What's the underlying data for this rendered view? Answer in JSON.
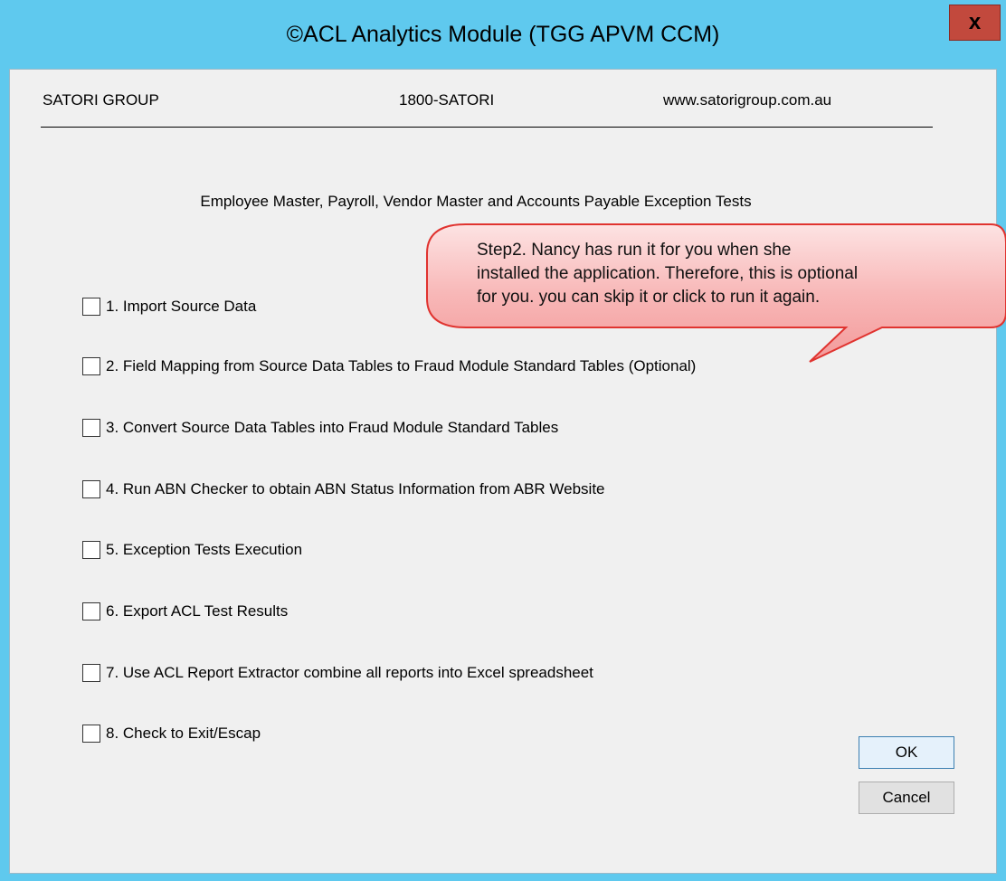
{
  "window": {
    "title": "©ACL Analytics Module (TGG APVM CCM)",
    "close_label": "x"
  },
  "header": {
    "company": "SATORI GROUP",
    "phone": "1800-SATORI",
    "website": "www.satorigroup.com.au"
  },
  "subtitle": "Employee Master, Payroll, Vendor Master and Accounts Payable Exception Tests",
  "options": [
    {
      "label": "1. Import Source Data",
      "checked": false
    },
    {
      "label": "2. Field Mapping from Source Data Tables to Fraud Module Standard Tables (Optional)",
      "checked": false
    },
    {
      "label": "3. Convert Source Data Tables into Fraud Module  Standard Tables",
      "checked": false
    },
    {
      "label": "4. Run ABN Checker to obtain ABN Status Information from ABR Website",
      "checked": false
    },
    {
      "label": "5. Exception Tests Execution",
      "checked": false
    },
    {
      "label": "6. Export ACL Test Results",
      "checked": false
    },
    {
      "label": "7. Use ACL Report Extractor combine all reports into Excel spreadsheet",
      "checked": false
    },
    {
      "label": "8. Check to Exit/Escap",
      "checked": false
    }
  ],
  "buttons": {
    "ok": "OK",
    "cancel": "Cancel"
  },
  "callout": {
    "line1": "Step2. Nancy has run it for you when she",
    "line2": "installed the application. Therefore, this is optional",
    "line3": "for you. you can skip it or click to run it again."
  },
  "colors": {
    "titlebar": "#5fc9ee",
    "close_button": "#c2493d",
    "callout_fill": "#f7b5b5",
    "callout_border": "#e0332f"
  }
}
